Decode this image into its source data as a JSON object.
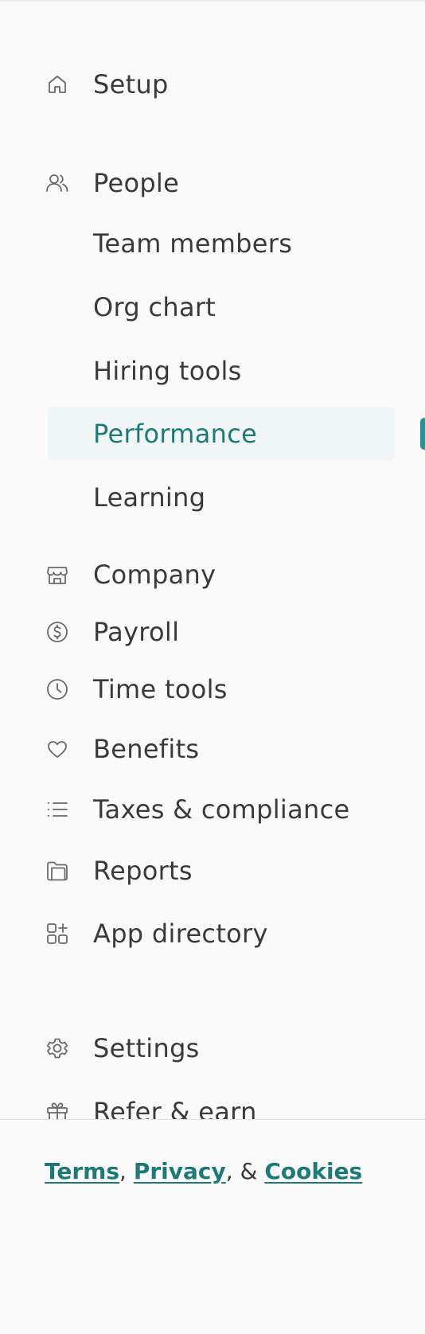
{
  "nav": {
    "setup": {
      "label": "Setup",
      "icon": "home-icon"
    },
    "people": {
      "label": "People",
      "icon": "people-icon"
    },
    "people_sub": [
      {
        "label": "Team members"
      },
      {
        "label": "Org chart"
      },
      {
        "label": "Hiring tools"
      },
      {
        "label": "Performance",
        "active": true
      },
      {
        "label": "Learning"
      }
    ],
    "company": {
      "label": "Company",
      "icon": "store-icon"
    },
    "payroll": {
      "label": "Payroll",
      "icon": "dollar-circle-icon"
    },
    "time_tools": {
      "label": "Time tools",
      "icon": "clock-icon"
    },
    "benefits": {
      "label": "Benefits",
      "icon": "heart-icon"
    },
    "taxes": {
      "label": "Taxes & compliance",
      "icon": "list-icon"
    },
    "reports": {
      "label": "Reports",
      "icon": "folder-icon"
    },
    "app_directory": {
      "label": "App directory",
      "icon": "apps-icon"
    },
    "settings": {
      "label": "Settings",
      "icon": "gear-icon"
    },
    "refer": {
      "label": "Refer & earn",
      "icon": "gift-icon"
    }
  },
  "footer": {
    "terms": "Terms",
    "sep1": ",",
    "privacy": "Privacy",
    "sep2": ", &",
    "cookies": "Cookies"
  },
  "colors": {
    "accent": "#1f7a77",
    "active_bg": "#f1f7f6",
    "text": "#3a3a3a",
    "background": "#fafafa"
  }
}
